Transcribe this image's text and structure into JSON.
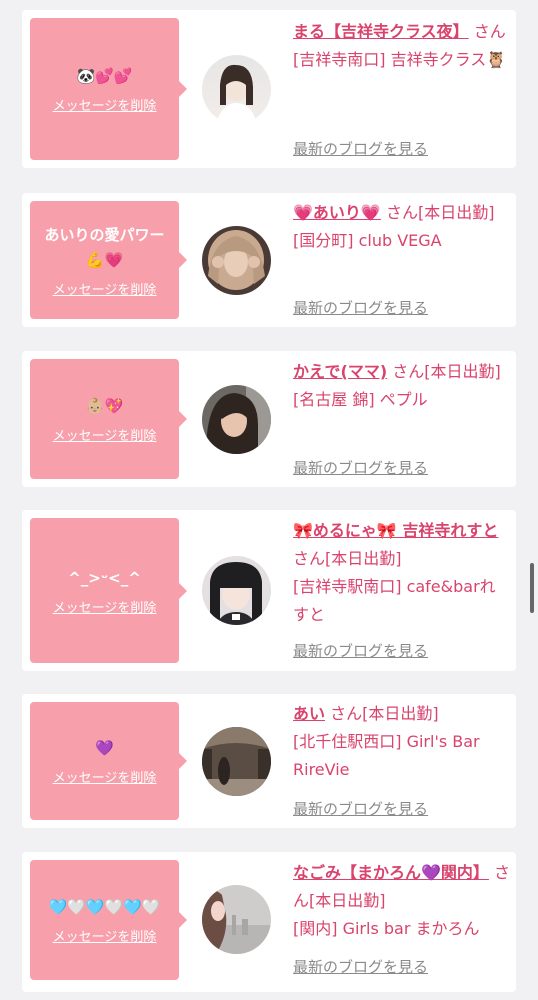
{
  "messages": [
    {
      "message": "🐼💕💕",
      "delete_label": "メッセージを削除",
      "name": "まる【吉祥寺クラス夜】",
      "san": "さん",
      "status": "",
      "shop": "[吉祥寺南口] 吉祥寺クラス🦉",
      "blog_label": "最新のブログを見る",
      "avatar_colors": [
        "#d9d9d9",
        "#efe7e1"
      ]
    },
    {
      "message": "あいりの愛パワー\n💪💗",
      "delete_label": "メッセージを削除",
      "name": "💗あいり💗",
      "san": "さん",
      "status": "[本日出勤]",
      "shop": "[国分町] club VEGA",
      "blog_label": "最新のブログを見る",
      "avatar_colors": [
        "#3b2c2a",
        "#c9a98f"
      ]
    },
    {
      "message": "👶🏼💖",
      "delete_label": "メッセージを削除",
      "name": "かえで(ママ)",
      "san": "さん",
      "status": "[本日出勤]",
      "shop": "[名古屋 錦] ペプル",
      "blog_label": "最新のブログを見る",
      "avatar_colors": [
        "#2f2a28",
        "#a48a78"
      ]
    },
    {
      "message": "^_>ᵕ<_^",
      "delete_label": "メッセージを削除",
      "name": "🎀めるにゃ🎀 吉祥寺れすと",
      "san": "さん",
      "status": "[本日出勤]",
      "shop": "[吉祥寺駅南口] cafe&barれすと",
      "blog_label": "最新のブログを見る",
      "avatar_colors": [
        "#1f1f22",
        "#e8e2e4"
      ]
    },
    {
      "message": "💜",
      "delete_label": "メッセージを削除",
      "name": "あい",
      "san": "さん",
      "status": "[本日出勤]",
      "shop": "[北千住駅西口] Girl's Bar RireVie",
      "blog_label": "最新のブログを見る",
      "avatar_colors": [
        "#4a3b33",
        "#a39387"
      ]
    },
    {
      "message": "🩵🤍🩵🤍🩵🤍",
      "delete_label": "メッセージを削除",
      "name": "なごみ【まかろん💜関内】",
      "san": "さん",
      "status": "[本日出勤]",
      "shop": "[関内] Girls bar まかろん",
      "blog_label": "最新のブログを見る",
      "avatar_colors": [
        "#c8c6c4",
        "#f0d6d4"
      ]
    }
  ]
}
